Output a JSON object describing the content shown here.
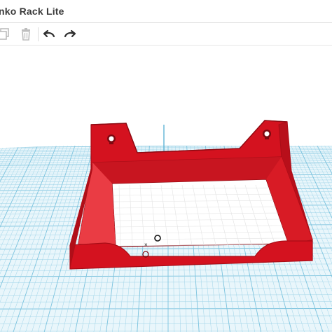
{
  "window": {
    "title": "nko Rack Lite"
  },
  "toolbar": {
    "buttons": [
      {
        "name": "duplicate",
        "icon": "duplicate-icon",
        "enabled": false
      },
      {
        "name": "delete",
        "icon": "trash-icon",
        "enabled": false
      },
      {
        "name": "undo",
        "icon": "undo-arrow-icon",
        "enabled": true
      },
      {
        "name": "redo",
        "icon": "redo-arrow-icon",
        "enabled": true
      }
    ]
  },
  "workplane": {
    "grid_color": "#9fd4e8",
    "grid_major_color": "#7cc3de",
    "axis_color": "#5fb4d6"
  },
  "model": {
    "shape": "rack-tray",
    "color": "#d4121f",
    "color_dark": "#a90d17",
    "color_light": "#e8323c"
  }
}
